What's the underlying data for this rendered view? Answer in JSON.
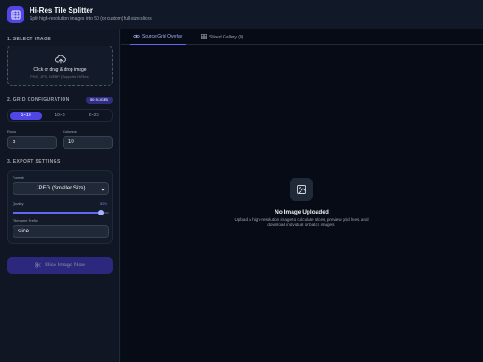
{
  "header": {
    "title": "Hi-Res Tile Splitter",
    "subtitle": "Split high-resolution images into 50 (or custom) full-size slices"
  },
  "sidebar": {
    "select_image": {
      "title": "1. SELECT IMAGE",
      "dropzone_text": "Click or drag & drop image",
      "dropzone_hint": "PNG, JPG, WEBP (Supports Hi-Res)"
    },
    "grid": {
      "title": "2. GRID CONFIGURATION",
      "badge": "50 SLICES",
      "presets": [
        "5×10",
        "10×5",
        "2×25"
      ],
      "active_preset": "5×10",
      "rows_label": "Rows",
      "rows_value": "5",
      "columns_label": "Columns",
      "columns_value": "10"
    },
    "export": {
      "title": "3. EXPORT SETTINGS",
      "format_label": "Format",
      "format_value": "JPEG (Smaller Size)",
      "quality_label": "Quality",
      "quality_value": "92%",
      "quality_fraction": 0.92,
      "prefix_label": "Filename Prefix",
      "prefix_value": "slice"
    },
    "slice_button": "Slice Image Now"
  },
  "main": {
    "tabs": [
      {
        "label": "Source Grid Overlay",
        "icon": "eye-icon"
      },
      {
        "label": "Sliced Gallery (0)",
        "icon": "grid-icon"
      }
    ],
    "active_tab": "Source Grid Overlay",
    "empty_state": {
      "title": "No Image Uploaded",
      "description": "Upload a high-resolution image to calculate slices, preview grid lines, and download individual or batch images."
    }
  },
  "colors": {
    "accent": "#4f46e5",
    "accent_light": "#a5b4fc",
    "background": "#0b0f1c",
    "panel": "#101623"
  }
}
